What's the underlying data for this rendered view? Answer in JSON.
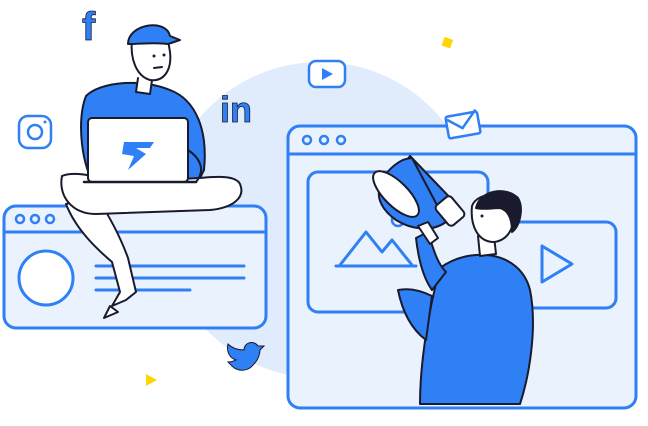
{
  "illustration": {
    "theme": "social-media-marketing",
    "colors": {
      "primary": "#2f7ff5",
      "light": "#dbe8fb",
      "outline": "#1a1a2e",
      "accent": "#ffd400",
      "white": "#ffffff"
    },
    "icons": [
      "facebook-icon",
      "linkedin-icon",
      "instagram-icon",
      "youtube-icon",
      "mail-icon",
      "twitter-icon",
      "image-icon",
      "play-icon",
      "megaphone-icon"
    ],
    "laptop_logo": "F"
  }
}
